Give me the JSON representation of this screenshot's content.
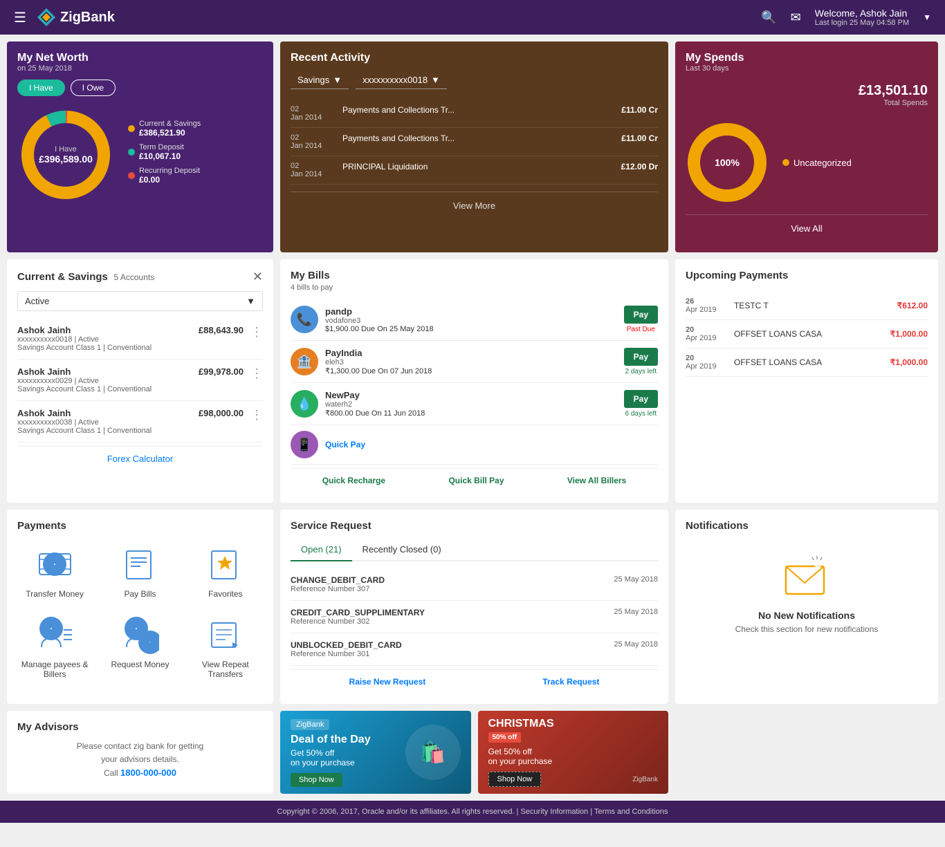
{
  "header": {
    "logo": "ZigBank",
    "welcome": "Welcome, Ashok Jain",
    "last_login": "Last login 25 May 04:58 PM"
  },
  "net_worth": {
    "title": "My Net Worth",
    "date": "on 25 May 2018",
    "tab_have": "I Have",
    "tab_owe": "I Owe",
    "label_title": "I Have",
    "label_value": "£396,589.00",
    "legend": [
      {
        "label": "Current & Savings",
        "value": "£386,521.90",
        "color": "#f0a500"
      },
      {
        "label": "Term Deposit",
        "value": "£10,067.10",
        "color": "#1abc9c"
      },
      {
        "label": "Recurring Deposit",
        "value": "£0.00",
        "color": "#e74c3c"
      }
    ]
  },
  "recent_activity": {
    "title": "Recent Activity",
    "filter1": "Savings",
    "filter2": "xxxxxxxxxx0018",
    "rows": [
      {
        "date": "02 Jan 2014",
        "desc": "Payments and Collections Tr...",
        "amount": "£11.00 Cr"
      },
      {
        "date": "02 Jan 2014",
        "desc": "Payments and Collections Tr...",
        "amount": "£11.00 Cr"
      },
      {
        "date": "02 Jan 2014",
        "desc": "PRINCIPAL Liquidation",
        "amount": "£12.00 Dr"
      }
    ],
    "view_more": "View More"
  },
  "my_spends": {
    "title": "My Spends",
    "subtitle": "Last 30 days",
    "total_value": "£13,501.10",
    "total_label": "Total Spends",
    "percent": "100%",
    "legend": "Uncategorized",
    "view_all": "View All"
  },
  "current_savings": {
    "title": "Current & Savings",
    "count": "5 Accounts",
    "filter": "Active",
    "accounts": [
      {
        "name": "Ashok Jainh",
        "num": "xxxxxxxxxx0018 | Active",
        "type": "Savings Account Class 1 | Conventional",
        "amount": "£88,643.90"
      },
      {
        "name": "Ashok Jainh",
        "num": "xxxxxxxxxx0029 | Active",
        "type": "Savings Account Class 1 | Conventional",
        "amount": "£99,978.00"
      },
      {
        "name": "Ashok Jainh",
        "num": "xxxxxxxxxx0038 | Active",
        "type": "Savings Account Class 1 | Conventional",
        "amount": "£98,000.00"
      }
    ],
    "forex_label": "Forex Calculator"
  },
  "my_bills": {
    "title": "My Bills",
    "subtitle": "4 bills to pay",
    "bills": [
      {
        "name": "pandp",
        "company": "vodafone3",
        "amount": "$1,900.00",
        "due": "Due On 25 May 2018",
        "status": "Past Due",
        "status_type": "past_due",
        "pay": "Pay"
      },
      {
        "name": "PayIndia",
        "company": "eleh3",
        "amount": "₹1,300.00",
        "due": "Due On 07 Jun 2018",
        "status": "2 days left",
        "status_type": "days_left",
        "pay": "Pay"
      },
      {
        "name": "NewPay",
        "company": "waterh2",
        "amount": "₹800.00",
        "due": "Due On 11 Jun 2018",
        "status": "6 days left",
        "status_type": "days_left",
        "pay": "Pay"
      }
    ],
    "quick_recharge": "Quick Recharge",
    "quick_bill_pay": "Quick Bill Pay",
    "quick_pay": "Quick Pay",
    "view_all_billers": "View All Billers"
  },
  "upcoming_payments": {
    "title": "Upcoming Payments",
    "items": [
      {
        "date_day": "26",
        "date_month": "Apr 2019",
        "name": "TESTC T",
        "amount": "₹612.00"
      },
      {
        "date_day": "20",
        "date_month": "Apr 2019",
        "name": "OFFSET LOANS CASA",
        "amount": "₹1,000.00"
      },
      {
        "date_day": "20",
        "date_month": "Apr 2019",
        "name": "OFFSET LOANS CASA",
        "amount": "₹1,000.00"
      }
    ]
  },
  "payments": {
    "title": "Payments",
    "items": [
      {
        "label": "Transfer Money",
        "icon": "transfer"
      },
      {
        "label": "Pay Bills",
        "icon": "bills"
      },
      {
        "label": "Favorites",
        "icon": "favorites"
      },
      {
        "label": "Manage payees & Billers",
        "icon": "payees"
      },
      {
        "label": "Request Money",
        "icon": "request"
      },
      {
        "label": "View Repeat Transfers",
        "icon": "repeat"
      }
    ]
  },
  "service_request": {
    "title": "Service Request",
    "tab_open": "Open (21)",
    "tab_closed": "Recently Closed (0)",
    "items": [
      {
        "name": "CHANGE_DEBIT_CARD",
        "ref": "Reference Number 307",
        "date": "25 May 2018"
      },
      {
        "name": "CREDIT_CARD_SUPPLIMENTARY",
        "ref": "Reference Number 302",
        "date": "25 May 2018"
      },
      {
        "name": "UNBLOCKED_DEBIT_CARD",
        "ref": "Reference Number 301",
        "date": "25 May 2018"
      }
    ],
    "raise_new": "Raise New Request",
    "track": "Track Request"
  },
  "notifications": {
    "title": "Notifications",
    "no_notifications": "No New Notifications",
    "check_text": "Check this section for new notifications"
  },
  "advisors": {
    "title": "My Advisors",
    "text": "Please contact zig bank for getting\nyour advisors details.",
    "call_label": "Call",
    "phone": "1800-000-000"
  },
  "banners": [
    {
      "tag": "ZigBank",
      "title": "Deal of the Day",
      "desc": "Get 50% off\non your purchase",
      "btn": "Shop Now",
      "type": "zigbank"
    },
    {
      "title": "CHRISTMAS",
      "badge": "50% off",
      "desc": "Get 50% off\non your purchase",
      "btn": "Shop Now",
      "type": "christmas"
    }
  ],
  "footer": {
    "text": "Copyright © 2006, 2017, Oracle and/or its affiliates. All rights reserved. | Security Information | Terms and Conditions"
  }
}
